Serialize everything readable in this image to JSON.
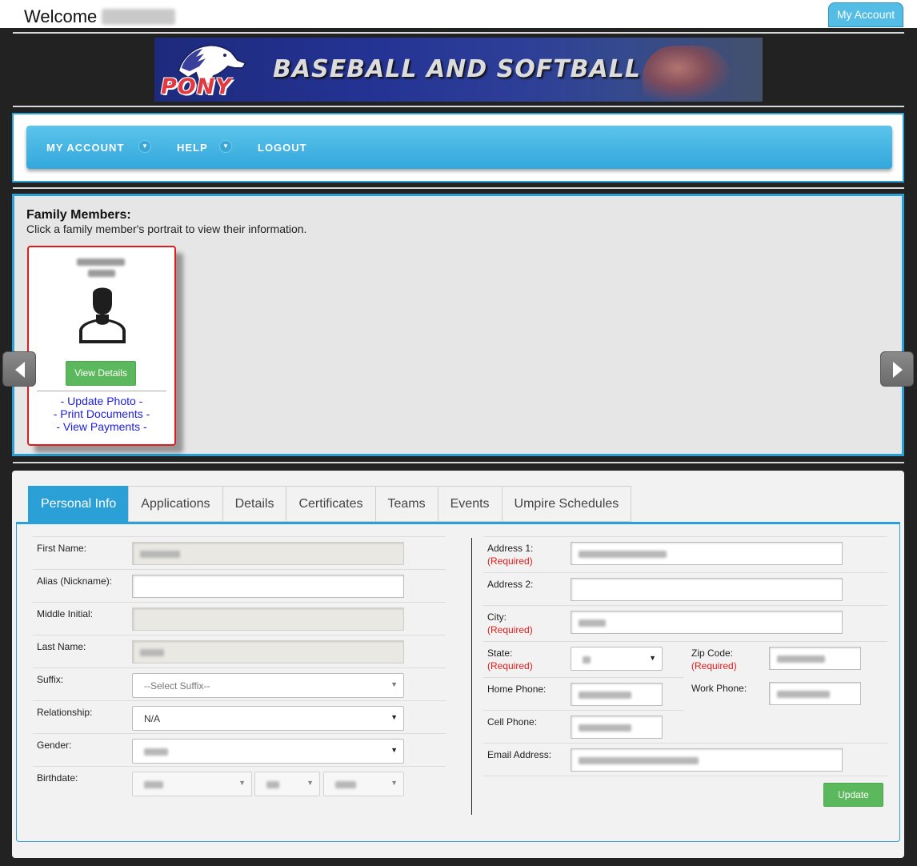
{
  "header": {
    "welcome_label": "Welcome",
    "my_account_button": "My Account"
  },
  "banner": {
    "logo_text": "PONY",
    "title": "BASEBALL AND SOFTBALL"
  },
  "nav": {
    "items": [
      {
        "label": "MY ACCOUNT",
        "has_dropdown": true
      },
      {
        "label": "HELP",
        "has_dropdown": true
      },
      {
        "label": "LOGOUT",
        "has_dropdown": false
      }
    ]
  },
  "family": {
    "title": "Family Members:",
    "subtitle": "Click a family member's portrait to view their information.",
    "card": {
      "view_details": "View Details",
      "links": [
        "- Update Photo -",
        "- Print Documents -",
        "- View Payments -"
      ]
    }
  },
  "tabs": [
    {
      "label": "Personal Info",
      "active": true
    },
    {
      "label": "Applications",
      "active": false
    },
    {
      "label": "Details",
      "active": false
    },
    {
      "label": "Certificates",
      "active": false
    },
    {
      "label": "Teams",
      "active": false
    },
    {
      "label": "Events",
      "active": false
    },
    {
      "label": "Umpire Schedules",
      "active": false
    }
  ],
  "form": {
    "left": {
      "first_name_label": "First Name:",
      "alias_label": "Alias (Nickname):",
      "middle_initial_label": "Middle Initial:",
      "last_name_label": "Last Name:",
      "suffix_label": "Suffix:",
      "suffix_value": "--Select Suffix--",
      "relationship_label": "Relationship:",
      "relationship_value": "N/A",
      "gender_label": "Gender:",
      "birthdate_label": "Birthdate:"
    },
    "right": {
      "address1_label": "Address 1:",
      "address2_label": "Address 2:",
      "city_label": "City:",
      "state_label": "State:",
      "zip_label": "Zip Code:",
      "home_phone_label": "Home Phone:",
      "work_phone_label": "Work Phone:",
      "cell_phone_label": "Cell Phone:",
      "email_label": "Email Address:",
      "required_text": "(Required)"
    },
    "update_button": "Update"
  },
  "colors": {
    "accent": "#2aa0d6",
    "nav_bar": "#33a7dc",
    "success_button": "#5cb85c",
    "required": "#e11b1b",
    "link": "#1d1de0",
    "card_border": "#e11b1b"
  },
  "icons": [
    "chevron-down-icon",
    "arrow-left-icon",
    "arrow-right-icon",
    "avatar-silhouette-icon",
    "select-caret-icon"
  ]
}
